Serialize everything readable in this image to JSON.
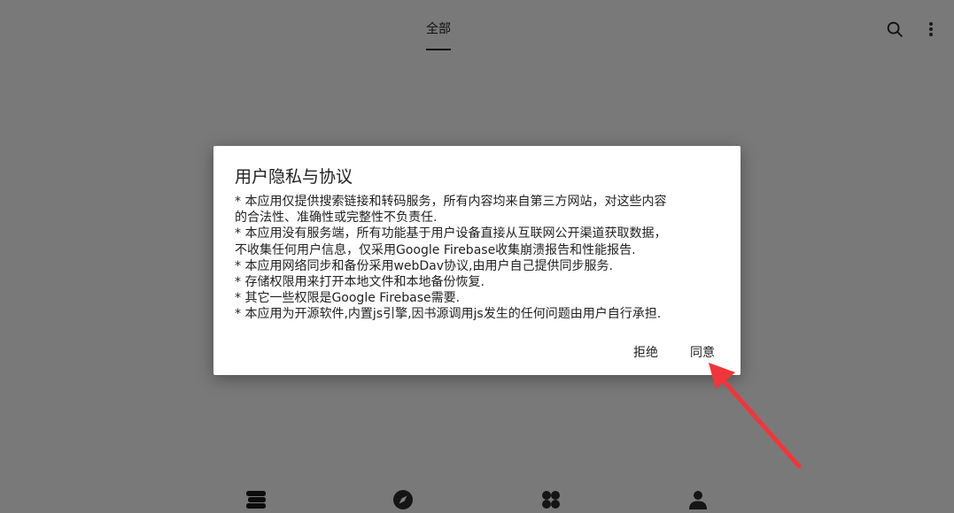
{
  "header": {
    "tab_all": "全部",
    "search_icon": "search-icon",
    "more_icon": "more-vert-icon"
  },
  "bottom_nav": {
    "items": [
      {
        "icon": "bookshelf-icon"
      },
      {
        "icon": "compass-icon"
      },
      {
        "icon": "grid-icon"
      },
      {
        "icon": "person-icon"
      }
    ]
  },
  "dialog": {
    "title": "用户隐私与协议",
    "lines": [
      "* 本应用仅提供搜索链接和转码服务，所有内容均来自第三方网站，对这些内容",
      "的合法性、准确性或完整性不负责任.",
      "* 本应用没有服务端，所有功能基于用户设备直接从互联网公开渠道获取数据，",
      "不收集任何用户信息，仅采用Google Firebase收集崩溃报告和性能报告.",
      "* 本应用网络同步和备份采用webDav协议,由用户自己提供同步服务.",
      "* 存储权限用来打开本地文件和本地备份恢复.",
      "* 其它一些权限是Google Firebase需要.",
      "* 本应用为开源软件,内置js引擎,因书源调用js发生的任何问题由用户自行承担."
    ],
    "reject_label": "拒绝",
    "agree_label": "同意"
  },
  "colors": {
    "scrim": "rgba(0,0,0,0.5)",
    "annotation_arrow": "#f2353a"
  }
}
